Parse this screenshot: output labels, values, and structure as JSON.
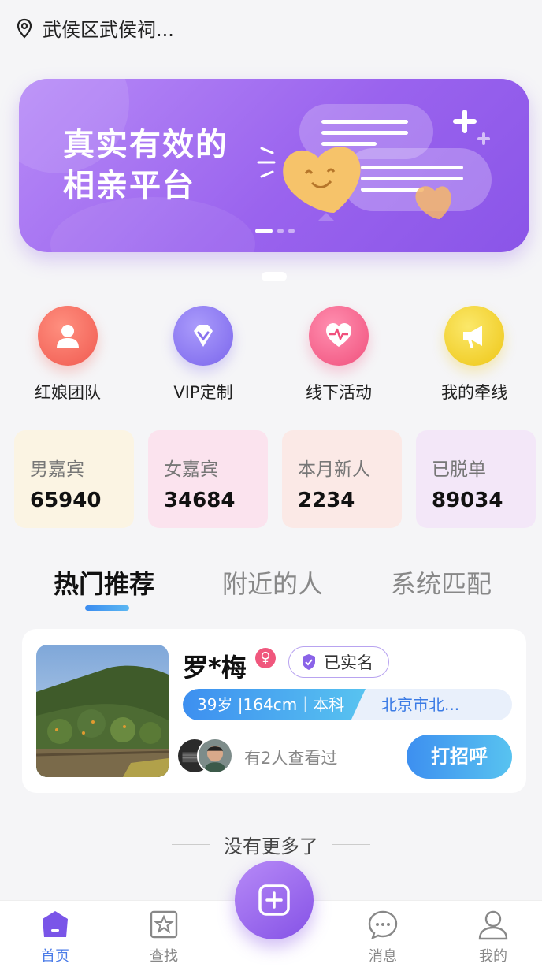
{
  "location": {
    "text": "武侯区武侯祠..."
  },
  "banner": {
    "line1": "真实有效的",
    "line2": "相亲平台"
  },
  "quick_actions": [
    {
      "label": "红娘团队",
      "icon": "matchmaker-icon",
      "color": "#f4665f"
    },
    {
      "label": "VIP定制",
      "icon": "diamond-icon",
      "color": "#8f7cf2"
    },
    {
      "label": "线下活动",
      "icon": "heart-pulse-icon",
      "color": "#f25c88"
    },
    {
      "label": "我的牵线",
      "icon": "megaphone-icon",
      "color": "#f0cf26"
    }
  ],
  "stats": [
    {
      "title": "男嘉宾",
      "value": "65940",
      "bg": "#fbf4e3"
    },
    {
      "title": "女嘉宾",
      "value": "34684",
      "bg": "#fbe3ee"
    },
    {
      "title": "本月新人",
      "value": "2234",
      "bg": "#fbe9e6"
    },
    {
      "title": "已脱单",
      "value": "89034",
      "bg": "#f3e7f8"
    }
  ],
  "tabs": [
    {
      "label": "热门推荐",
      "active": true
    },
    {
      "label": "附近的人",
      "active": false
    },
    {
      "label": "系统匹配",
      "active": false
    }
  ],
  "profile": {
    "name": "罗*梅",
    "gender_symbol": "♀",
    "verified": "已实名",
    "info": "39岁 |164cm｜本科",
    "city": "北京市北...",
    "viewed": "有2人查看过",
    "greet": "打招呼"
  },
  "no_more": "没有更多了",
  "tabbar": [
    {
      "label": "首页",
      "icon": "home-icon",
      "active": true
    },
    {
      "label": "查找",
      "icon": "search-star-icon",
      "active": false
    },
    {
      "label": "消息",
      "icon": "message-icon",
      "active": false
    },
    {
      "label": "我的",
      "icon": "user-icon",
      "active": false
    }
  ],
  "colors": {
    "accent": "#4a7be8",
    "banner": "#9a63ee"
  }
}
